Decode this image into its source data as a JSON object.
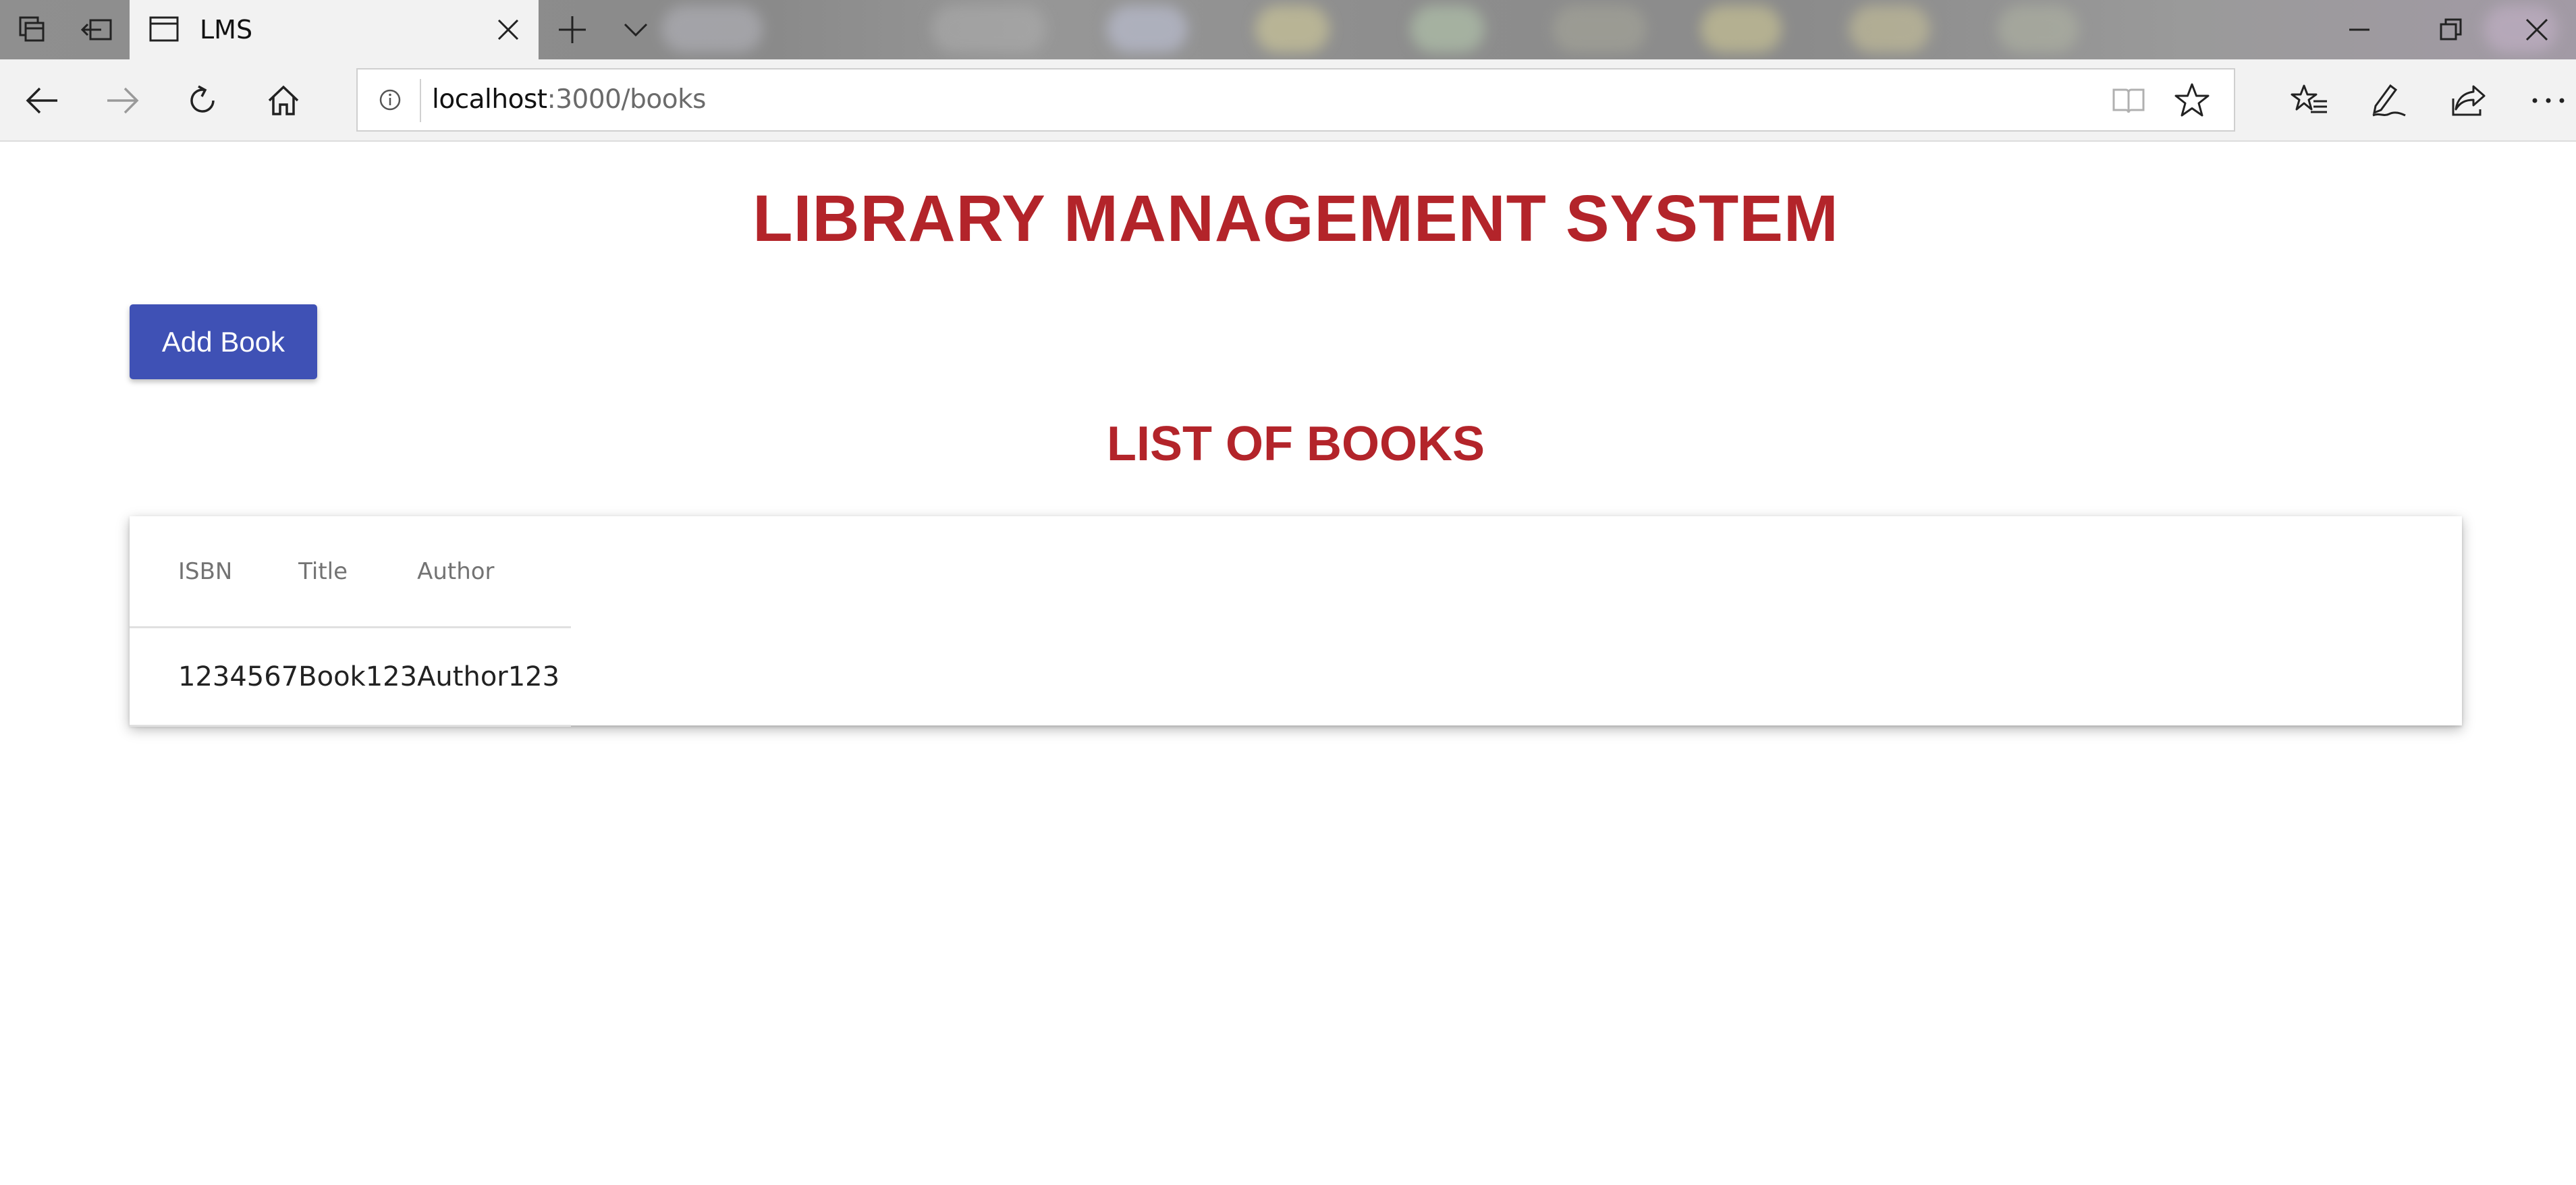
{
  "browser": {
    "tab_title": "LMS",
    "url_host": "localhost",
    "url_rest": ":3000/books",
    "icons": {
      "tab_actions": [
        "tabs-aside-icon",
        "set-aside-tabs-icon"
      ],
      "new_tab": "plus-icon",
      "tab_list": "chevron-down-icon",
      "window": [
        "minimize-icon",
        "restore-icon",
        "close-icon"
      ],
      "nav": [
        "back-arrow-icon",
        "forward-arrow-icon",
        "refresh-icon",
        "home-icon"
      ],
      "address": [
        "info-icon",
        "reading-view-icon",
        "favorite-star-icon"
      ],
      "toolbar": [
        "favorites-list-icon",
        "pen-notes-icon",
        "share-icon",
        "more-dots-icon"
      ]
    }
  },
  "page": {
    "title": "LIBRARY MANAGEMENT SYSTEM",
    "add_button_label": "Add Book",
    "list_title": "LIST OF BOOKS",
    "table": {
      "headers": [
        "ISBN",
        "Title",
        "Author"
      ],
      "rows": [
        [
          "1234567",
          "Book123",
          "Author123"
        ]
      ]
    }
  },
  "colors": {
    "heading": "#b3242a",
    "button": "#3f51b5",
    "chrome": "#f2f2f2"
  }
}
